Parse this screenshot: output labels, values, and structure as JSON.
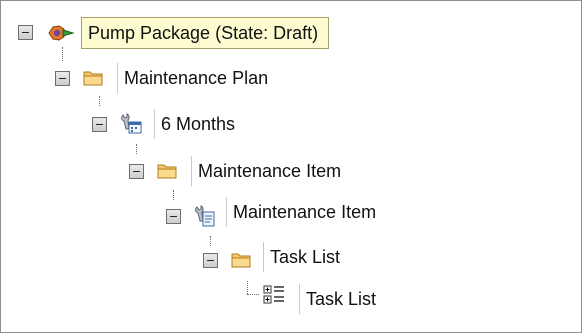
{
  "tree": {
    "root_label": "Pump Package (State: Draft)",
    "nodes": [
      {
        "label": "Maintenance Plan",
        "icon": "folder-icon"
      },
      {
        "label": "6 Months",
        "icon": "wrench-calendar-icon"
      },
      {
        "label": "Maintenance Item",
        "icon": "folder-icon"
      },
      {
        "label": "Maintenance Item",
        "icon": "wrench-document-icon"
      },
      {
        "label": "Task List",
        "icon": "folder-icon"
      },
      {
        "label": "Task List",
        "icon": "task-list-icon"
      }
    ]
  }
}
